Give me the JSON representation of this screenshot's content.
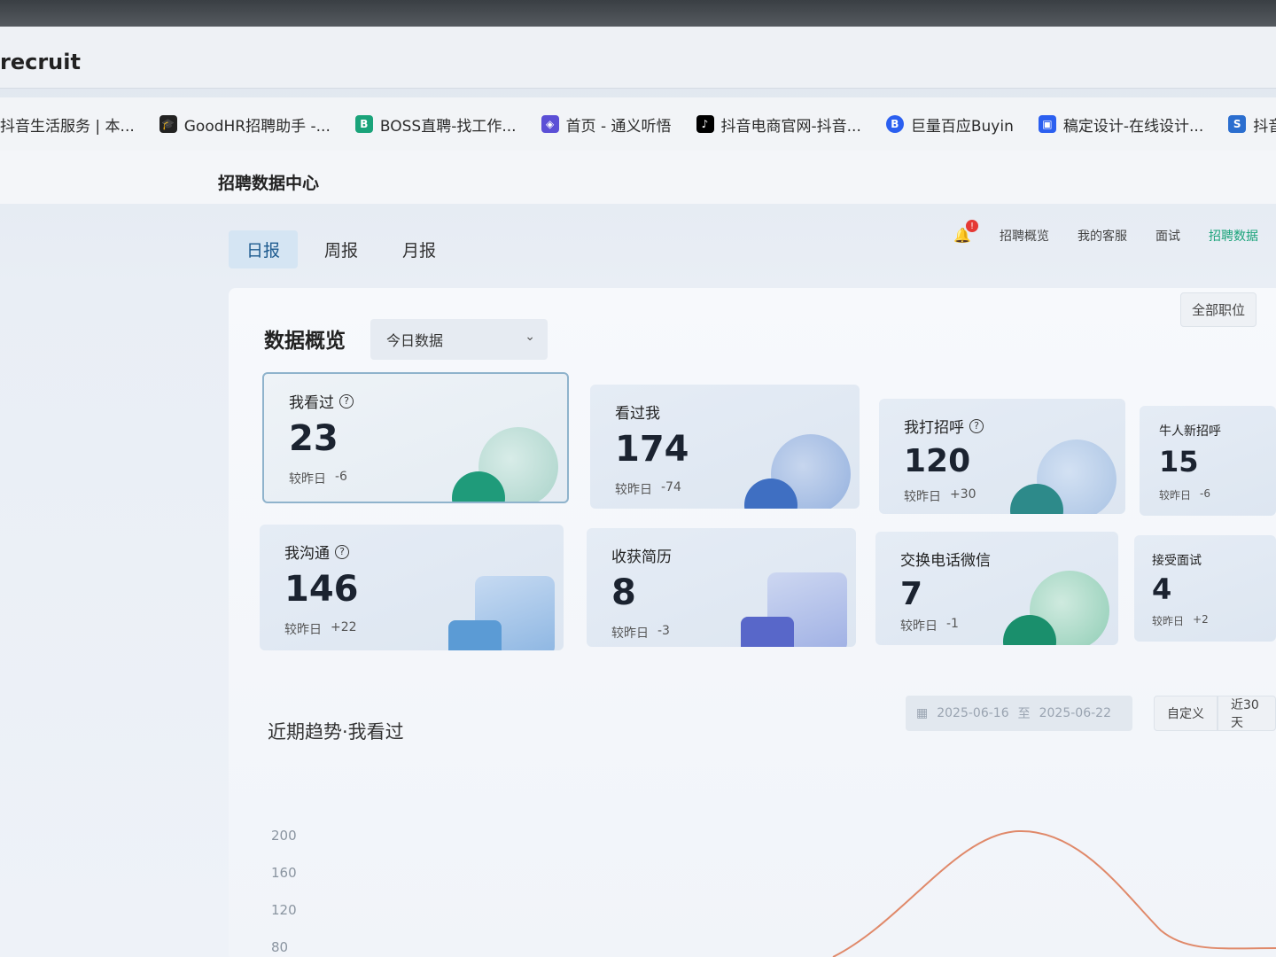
{
  "window": {
    "title": "recruit"
  },
  "bookmarks": [
    {
      "label": "抖音生活服务 | 本...",
      "icon": "douyin-icon",
      "color": "#000000"
    },
    {
      "label": "GoodHR招聘助手 -...",
      "icon": "graduation-cap-icon",
      "color": "#222222"
    },
    {
      "label": "BOSS直聘-找工作...",
      "icon": "boss-icon",
      "color": "#1aa37a"
    },
    {
      "label": "首页 - 通义听悟",
      "icon": "tongyi-icon",
      "color": "#5b4fd6"
    },
    {
      "label": "抖音电商官网-抖音...",
      "icon": "tiktok-icon",
      "color": "#000000"
    },
    {
      "label": "巨量百应Buyin",
      "icon": "buyin-icon",
      "color": "#2b5ff0"
    },
    {
      "label": "稿定设计-在线设计...",
      "icon": "gaoding-icon",
      "color": "#2b5ff0"
    },
    {
      "label": "抖音集星",
      "icon": "jixing-icon",
      "color": "#2b6ecf"
    }
  ],
  "header": {
    "brand": "招聘数据中心",
    "notification_count": "!",
    "nav": [
      "招聘概览",
      "我的客服",
      "面试",
      "招聘数据"
    ]
  },
  "tabs": [
    "日报",
    "周报",
    "月报"
  ],
  "overview": {
    "title": "数据概览",
    "select_value": "今日数据",
    "scope_button": "全部职位"
  },
  "cards": [
    {
      "label": "我看过",
      "value": "23",
      "delta_label": "较昨日",
      "delta": "-6",
      "help": true
    },
    {
      "label": "看过我",
      "value": "174",
      "delta_label": "较昨日",
      "delta": "-74",
      "help": false
    },
    {
      "label": "我打招呼",
      "value": "120",
      "delta_label": "较昨日",
      "delta": "+30",
      "help": true
    },
    {
      "label": "牛人新招呼",
      "value": "15",
      "delta_label": "较昨日",
      "delta": "-6",
      "help": false
    },
    {
      "label": "我沟通",
      "value": "146",
      "delta_label": "较昨日",
      "delta": "+22",
      "help": true
    },
    {
      "label": "收获简历",
      "value": "8",
      "delta_label": "较昨日",
      "delta": "-3",
      "help": false
    },
    {
      "label": "交换电话微信",
      "value": "7",
      "delta_label": "较昨日",
      "delta": "-1",
      "help": false
    },
    {
      "label": "接受面试",
      "value": "4",
      "delta_label": "较昨日",
      "delta": "+2",
      "help": false
    }
  ],
  "trend": {
    "title": "近期趋势·我看过",
    "date_start": "2025-06-16",
    "date_sep": "至",
    "date_end": "2025-06-22",
    "custom_button": "自定义",
    "range_button": "近30天"
  },
  "chart_data": {
    "type": "line",
    "y_ticks": [
      "200",
      "160",
      "120",
      "80"
    ],
    "line_color": "#e0896a"
  }
}
